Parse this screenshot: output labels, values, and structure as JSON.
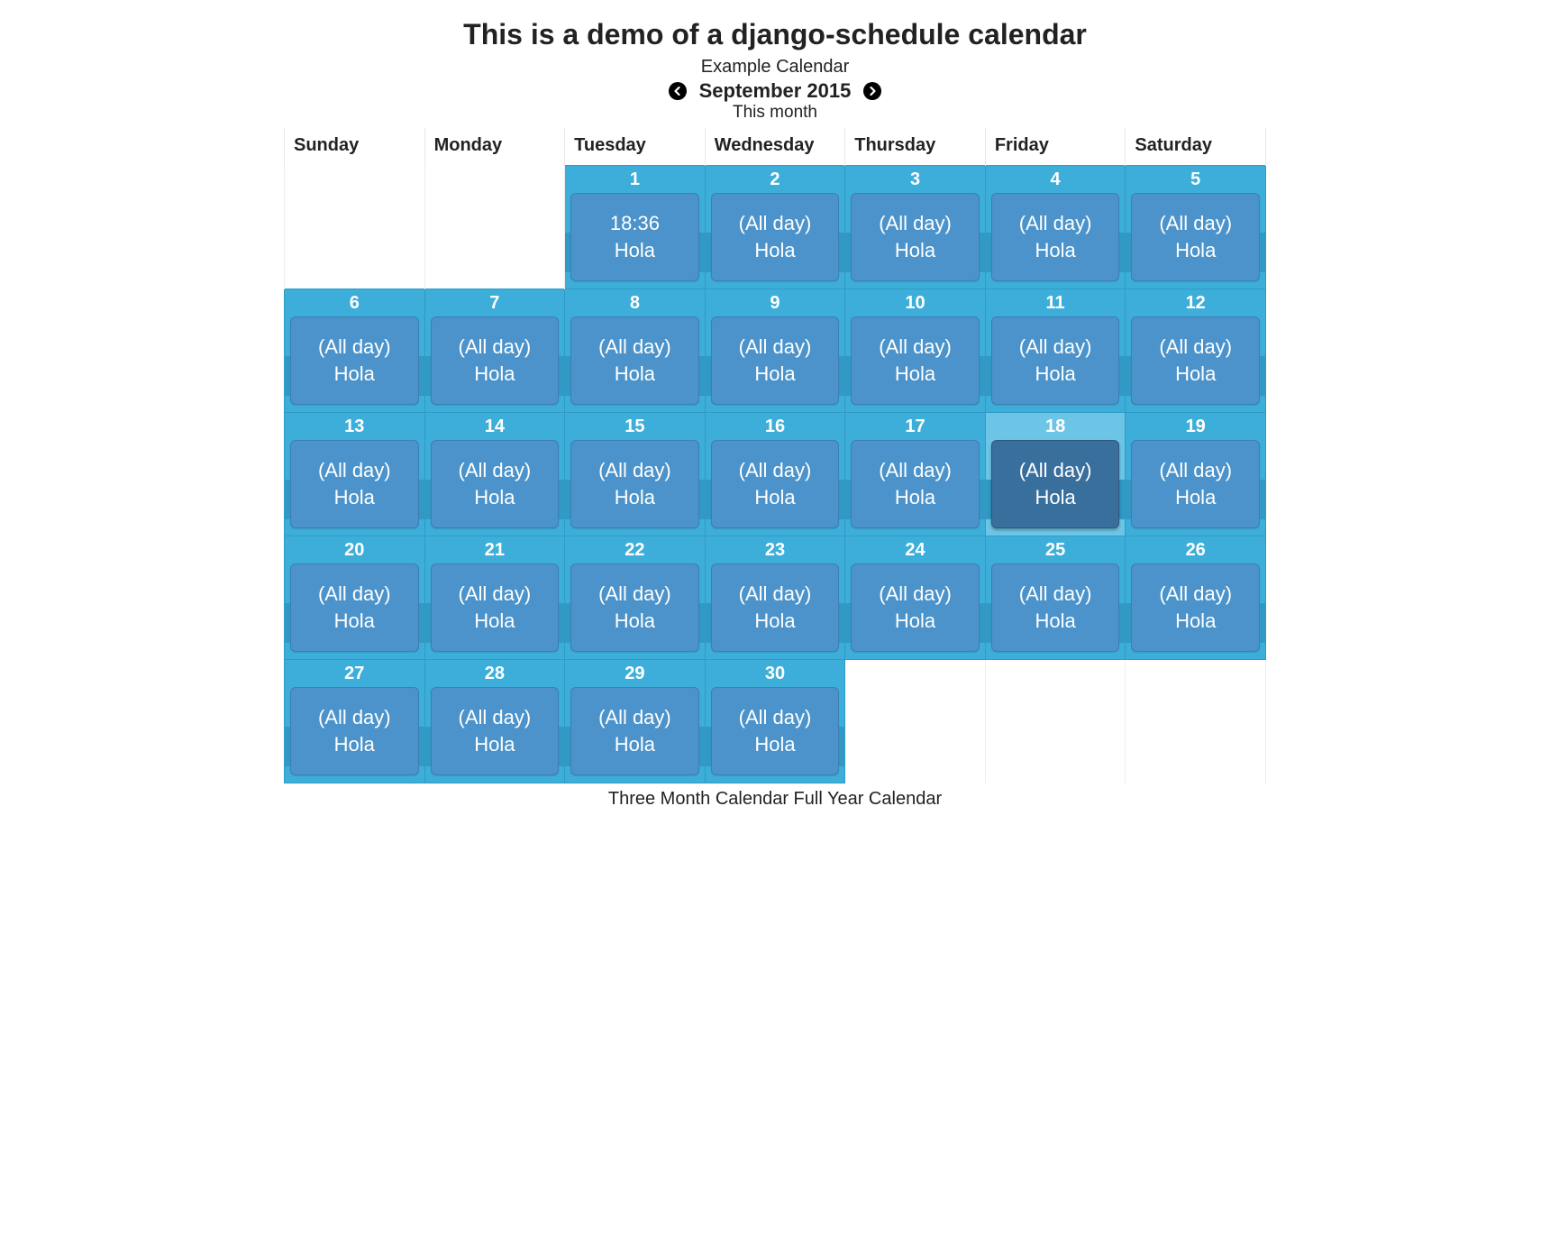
{
  "title": "This is a demo of a django-schedule calendar",
  "subtitle": "Example Calendar",
  "month_label": "September 2015",
  "this_month_label": "This month",
  "weekday_headers": [
    "Sunday",
    "Monday",
    "Tuesday",
    "Wednesday",
    "Thursday",
    "Friday",
    "Saturday"
  ],
  "all_day_label": "(All day)",
  "event_title": "Hola",
  "first_event_time": "18:36",
  "today_day": 18,
  "footer": {
    "three_month": "Three Month Calendar",
    "full_year": "Full Year Calendar"
  },
  "weeks": [
    [
      null,
      null,
      1,
      2,
      3,
      4,
      5
    ],
    [
      6,
      7,
      8,
      9,
      10,
      11,
      12
    ],
    [
      13,
      14,
      15,
      16,
      17,
      18,
      19
    ],
    [
      20,
      21,
      22,
      23,
      24,
      25,
      26
    ],
    [
      27,
      28,
      29,
      30,
      null,
      null,
      null
    ]
  ]
}
